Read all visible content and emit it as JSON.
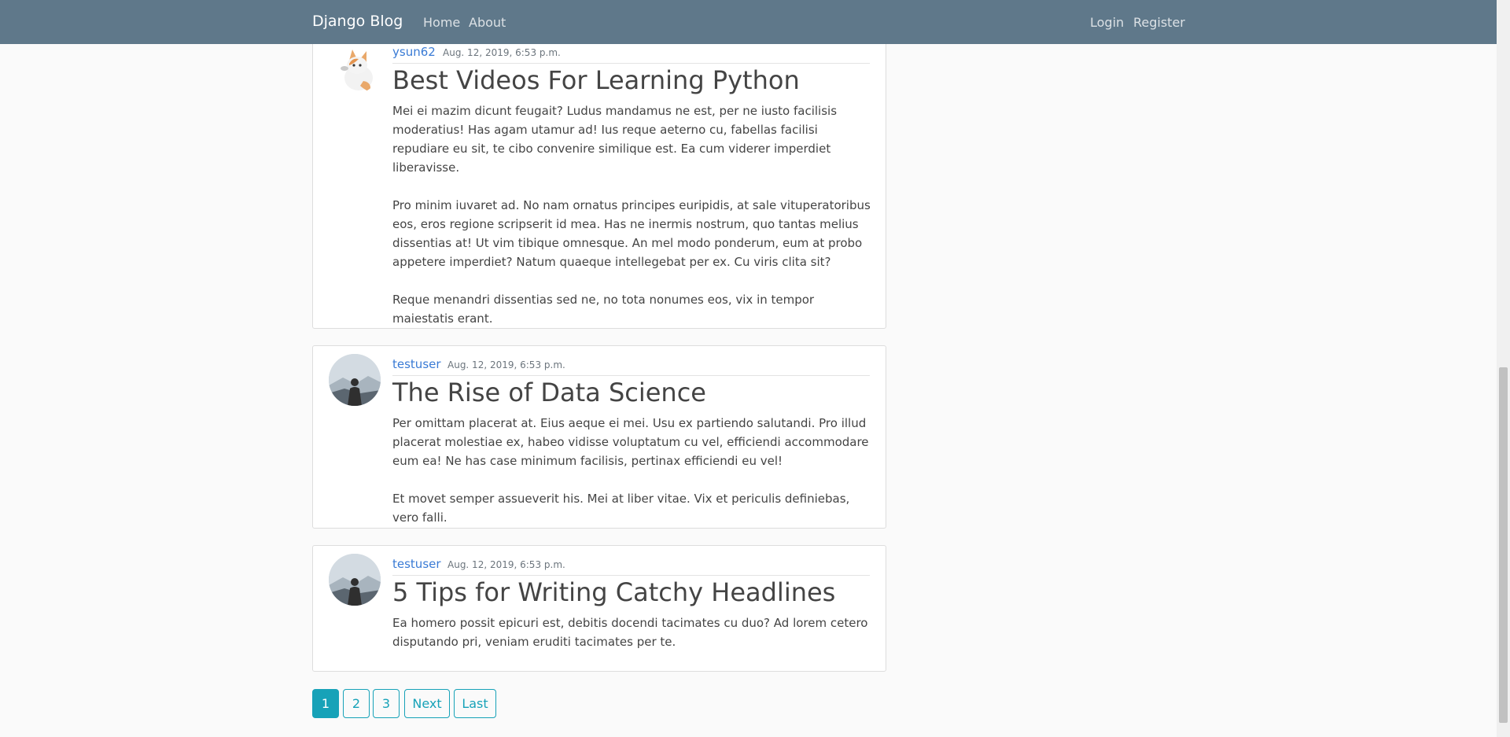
{
  "nav": {
    "brand": "Django Blog",
    "links": [
      "Home",
      "About"
    ],
    "auth": [
      "Login",
      "Register"
    ]
  },
  "posts": [
    {
      "author": "ysun62",
      "date": "Aug. 12, 2019, 6:53 p.m.",
      "avatar": "cat-avatar",
      "title": "Best Videos For Learning Python",
      "paragraphs": [
        "Mei ei mazim dicunt feugait? Ludus mandamus ne est, per ne iusto facilisis moderatius! Has agam utamur ad! Ius reque aeterno cu, fabellas facilisi repudiare eu sit, te cibo convenire similique est. Ea cum viderer imperdiet liberavisse.",
        "Pro minim iuvaret ad. No nam ornatus principes euripidis, at sale vituperatoribus eos, eros regione scripserit id mea. Has ne inermis nostrum, quo tantas melius dissentias at! Ut vim tibique omnesque. An mel modo ponderum, eum at probo appetere imperdiet? Natum quaeque intellegebat per ex. Cu viris clita sit?",
        "Reque menandri dissentias sed ne, no tota nonumes eos, vix in tempor maiestatis erant."
      ]
    },
    {
      "author": "testuser",
      "date": "Aug. 12, 2019, 6:53 p.m.",
      "avatar": "person-avatar",
      "title": "The Rise of Data Science",
      "paragraphs": [
        "Per omittam placerat at. Eius aeque ei mei. Usu ex partiendo salutandi. Pro illud placerat molestiae ex, habeo vidisse voluptatum cu vel, efficiendi accommodare eum ea! Ne has case minimum facilisis, pertinax efficiendi eu vel!",
        "Et movet semper assueverit his. Mei at liber vitae. Vix et periculis definiebas, vero falli."
      ]
    },
    {
      "author": "testuser",
      "date": "Aug. 12, 2019, 6:53 p.m.",
      "avatar": "person-avatar",
      "title": "5 Tips for Writing Catchy Headlines",
      "paragraphs": [
        "Ea homero possit epicuri est, debitis docendi tacimates cu duo? Ad lorem cetero disputando pri, veniam eruditi tacimates per te."
      ]
    }
  ],
  "pagination": {
    "pages": [
      "1",
      "2",
      "3"
    ],
    "active": "1",
    "next": "Next",
    "last": "Last"
  },
  "colors": {
    "navbar": "#5f788a",
    "accent": "#17a2b8",
    "link": "#3a7bd5"
  }
}
